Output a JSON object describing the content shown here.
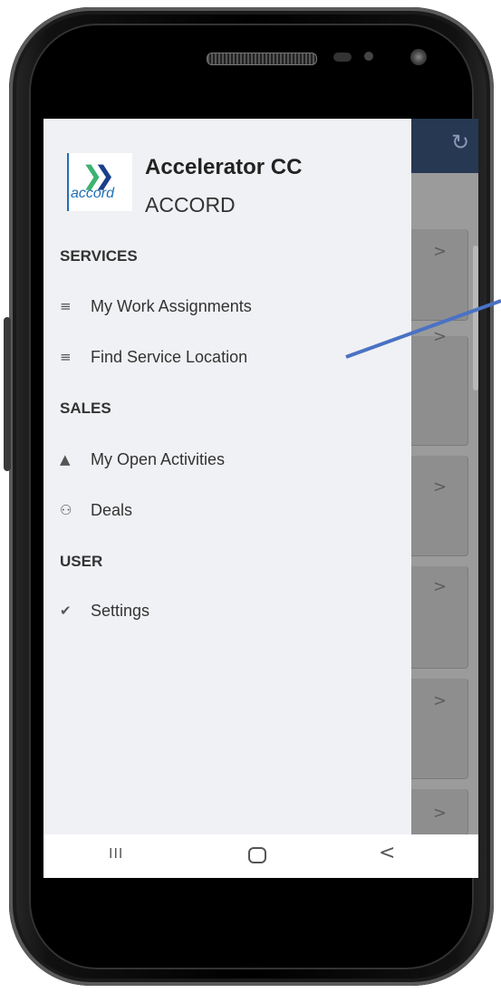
{
  "brand": {
    "logo_text": "accord",
    "title": "Accelerator CC",
    "subtitle": "ACCORD"
  },
  "menu": {
    "services_header": "SERVICES",
    "services": [
      {
        "label": "My Work Assignments",
        "icon": "list-icon"
      },
      {
        "label": "Find Service Location",
        "icon": "list-icon"
      }
    ],
    "sales_header": "SALES",
    "sales": [
      {
        "label": "My Open Activities",
        "icon": "bell-icon"
      },
      {
        "label": "Deals",
        "icon": "people-icon"
      }
    ],
    "user_header": "USER",
    "user": [
      {
        "label": "Settings",
        "icon": "check-circle-icon"
      }
    ]
  },
  "navbar": {
    "recents": "III",
    "back": "<"
  },
  "colors": {
    "header": "#263852",
    "drawer_bg": "#f0f1f4",
    "annotation": "#4a72c4"
  }
}
